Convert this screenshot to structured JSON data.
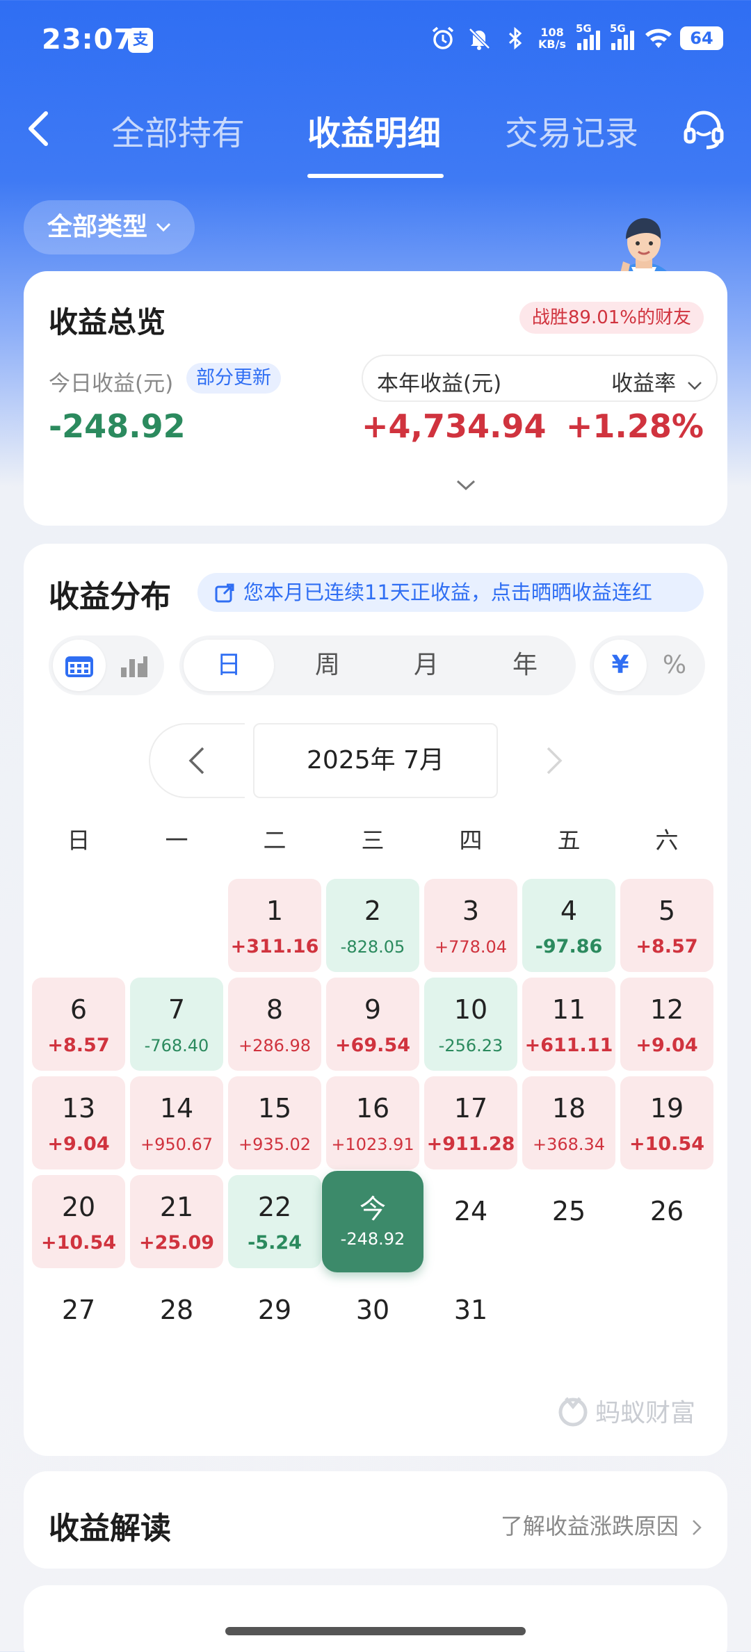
{
  "status_bar": {
    "time": "23:07",
    "app_badge": "支",
    "net_speed_top": "108",
    "net_speed_bottom": "KB/s",
    "sim1": "5G",
    "sim2": "5G",
    "battery": "64",
    "icons": [
      "alarm-icon",
      "mute-bell-icon",
      "bluetooth-icon",
      "signal-icon",
      "wifi-icon",
      "battery-icon"
    ]
  },
  "nav": {
    "tabs": [
      {
        "label": "全部持有",
        "active": false
      },
      {
        "label": "收益明细",
        "active": true
      },
      {
        "label": "交易记录",
        "active": false
      }
    ]
  },
  "filter": {
    "label": "全部类型"
  },
  "overview": {
    "title": "收益总览",
    "badge": "战胜89.01%的财友",
    "today_label": "今日收益(元)",
    "partial_tag": "部分更新",
    "today_value": "-248.92",
    "year_label": "本年收益(元)",
    "rate_label": "收益率",
    "year_value": "+4,734.94",
    "rate_value": "+1.28%"
  },
  "distribution": {
    "title": "收益分布",
    "streak_text": "您本月已连续11天正收益，点击晒晒收益连红",
    "periods": [
      "日",
      "周",
      "月",
      "年"
    ],
    "active_period": "日",
    "units": [
      "¥",
      "%"
    ],
    "active_unit": "¥",
    "month": "2025年 7月",
    "weekdays": [
      "日",
      "一",
      "二",
      "三",
      "四",
      "五",
      "六"
    ],
    "days": [
      {
        "d": "1",
        "v": "+311.16",
        "t": "pos"
      },
      {
        "d": "2",
        "v": "-828.05",
        "t": "neg"
      },
      {
        "d": "3",
        "v": "+778.04",
        "t": "pos"
      },
      {
        "d": "4",
        "v": "-97.86",
        "t": "neg"
      },
      {
        "d": "5",
        "v": "+8.57",
        "t": "pos"
      },
      {
        "d": "6",
        "v": "+8.57",
        "t": "pos"
      },
      {
        "d": "7",
        "v": "-768.40",
        "t": "neg"
      },
      {
        "d": "8",
        "v": "+286.98",
        "t": "pos"
      },
      {
        "d": "9",
        "v": "+69.54",
        "t": "pos"
      },
      {
        "d": "10",
        "v": "-256.23",
        "t": "neg"
      },
      {
        "d": "11",
        "v": "+611.11",
        "t": "pos"
      },
      {
        "d": "12",
        "v": "+9.04",
        "t": "pos"
      },
      {
        "d": "13",
        "v": "+9.04",
        "t": "pos"
      },
      {
        "d": "14",
        "v": "+950.67",
        "t": "pos"
      },
      {
        "d": "15",
        "v": "+935.02",
        "t": "pos"
      },
      {
        "d": "16",
        "v": "+1023.91",
        "t": "pos"
      },
      {
        "d": "17",
        "v": "+911.28",
        "t": "pos"
      },
      {
        "d": "18",
        "v": "+368.34",
        "t": "pos"
      },
      {
        "d": "19",
        "v": "+10.54",
        "t": "pos"
      },
      {
        "d": "20",
        "v": "+10.54",
        "t": "pos"
      },
      {
        "d": "21",
        "v": "+25.09",
        "t": "pos"
      },
      {
        "d": "22",
        "v": "-5.24",
        "t": "neg"
      },
      {
        "d": "今",
        "v": "-248.92",
        "t": "today"
      },
      {
        "d": "24",
        "v": "",
        "t": "empty"
      },
      {
        "d": "25",
        "v": "",
        "t": "empty"
      },
      {
        "d": "26",
        "v": "",
        "t": "empty"
      },
      {
        "d": "27",
        "v": "",
        "t": "empty"
      },
      {
        "d": "28",
        "v": "",
        "t": "empty"
      },
      {
        "d": "29",
        "v": "",
        "t": "empty"
      },
      {
        "d": "30",
        "v": "",
        "t": "empty"
      },
      {
        "d": "31",
        "v": "",
        "t": "empty"
      }
    ],
    "first_weekday_index": 2,
    "watermark": "蚂蚁财富"
  },
  "interpret": {
    "title": "收益解读",
    "link": "了解收益涨跌原因"
  },
  "colors": {
    "brand_blue": "#2f6ef3",
    "gain_red": "#d0333e",
    "loss_green": "#2b8a5e",
    "today_green": "#3c8a6a"
  }
}
